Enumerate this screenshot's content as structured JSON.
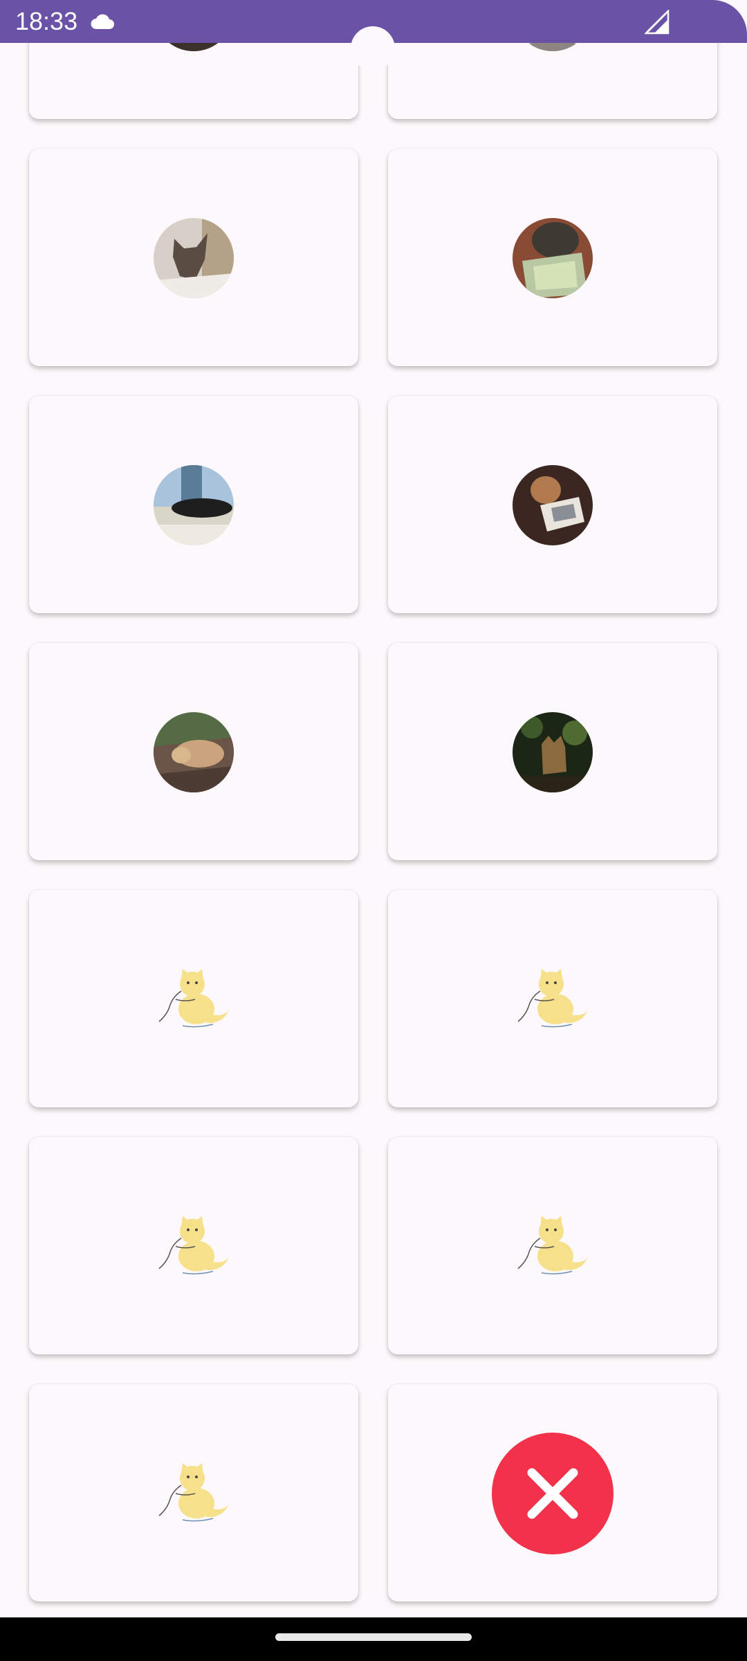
{
  "status_bar": {
    "time": "18:33",
    "icons": [
      "cloud-icon",
      "signal-icon"
    ]
  },
  "grid": {
    "photos": [
      {
        "subject": "cat-photo-grey"
      },
      {
        "subject": "cat-photo-tabby-table"
      },
      {
        "subject": "cat-photo-black-windowsill"
      },
      {
        "subject": "cat-photo-calico-box"
      },
      {
        "subject": "cat-photo-ginger-sofa"
      },
      {
        "subject": "cat-photo-dark-garden"
      }
    ],
    "placeholder_icon": "yellow-cat-with-yarn-icon",
    "placeholder_count": 5,
    "error_icon": "close-icon",
    "error_color": "#f2314a"
  },
  "colors": {
    "status_bar": "#6a52a6",
    "background": "#fdf8fb",
    "nav_bar": "#000000"
  }
}
